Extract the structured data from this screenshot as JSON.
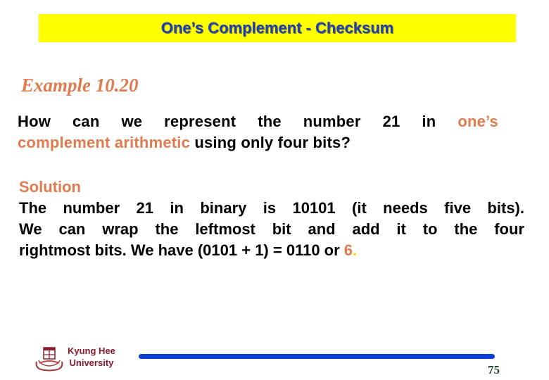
{
  "slide": {
    "title": "One’s Complement - Checksum",
    "example_label": "Example 10.20",
    "question": {
      "line1_text": "How can we represent the number 21 in ",
      "line1_accent": "one’s",
      "line2_accent": "complement arithmetic",
      "line2_text": " using only four bits?"
    },
    "solution": {
      "heading": "Solution",
      "line1": "The number 21 in binary is 10101 (it needs five bits).",
      "line2": "We can wrap the leftmost bit and add it to the four",
      "line3_text": "rightmost bits. We have (0101 + 1) = 0110 or ",
      "line3_answer": "6",
      "line3_period": "."
    },
    "colors": {
      "title_bar": "#ffff00",
      "title_text": "#1f3fb0",
      "accent": "#e07b50",
      "rule": "#0a3fd8",
      "university": "#8b1a2a",
      "page_number": "#1e4a2a"
    }
  },
  "footer": {
    "logo_icon": "university-crest-icon",
    "university_line1": "Kyung Hee",
    "university_line2": "University",
    "page_number": "75"
  }
}
